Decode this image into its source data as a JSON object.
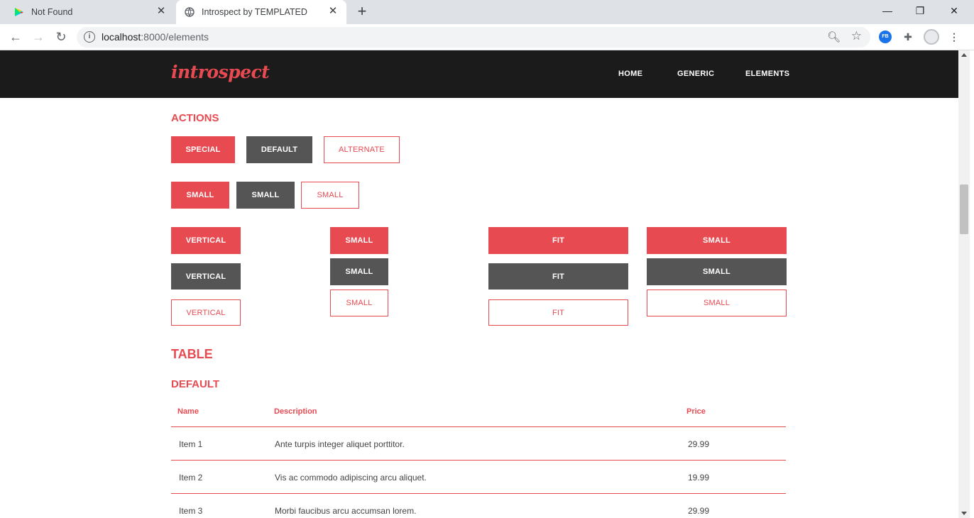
{
  "browser": {
    "tabs": [
      {
        "title": "Not Found"
      },
      {
        "title": "Introspect by TEMPLATED"
      }
    ],
    "url_host": "localhost",
    "url_path": ":8000/elements",
    "extension_fb_label": "FB"
  },
  "site": {
    "logo": "introspect",
    "nav": [
      "HOME",
      "GENERIC",
      "ELEMENTS"
    ]
  },
  "actions": {
    "heading": "ACTIONS",
    "row1": [
      "SPECIAL",
      "DEFAULT",
      "ALTERNATE"
    ],
    "row2": [
      "SMALL",
      "SMALL",
      "SMALL"
    ],
    "vertical": [
      "VERTICAL",
      "VERTICAL",
      "VERTICAL"
    ],
    "vertical_small": [
      "SMALL",
      "SMALL",
      "SMALL"
    ],
    "fit": [
      "FIT",
      "FIT",
      "FIT"
    ],
    "fit_small": [
      "SMALL",
      "SMALL",
      "SMALL"
    ]
  },
  "table": {
    "heading": "TABLE",
    "subheading": "DEFAULT",
    "columns": [
      "Name",
      "Description",
      "Price"
    ],
    "rows": [
      [
        "Item 1",
        "Ante turpis integer aliquet porttitor.",
        "29.99"
      ],
      [
        "Item 2",
        "Vis ac commodo adipiscing arcu aliquet.",
        "19.99"
      ],
      [
        "Item 3",
        "Morbi faucibus arcu accumsan lorem.",
        "29.99"
      ]
    ]
  },
  "colors": {
    "accent": "#e84a51",
    "dark_button": "#555555",
    "header_bg": "#1b1b1b"
  }
}
